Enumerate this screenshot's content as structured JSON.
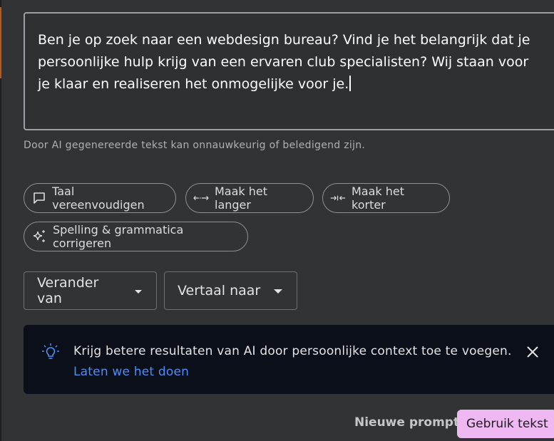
{
  "editor": {
    "text": "Ben je op zoek naar een webdesign bureau? Vind je het belangrijk dat je persoonlijke hulp krijg van een ervaren club specialisten? Wij staan voor je klaar en realiseren het onmogelijke voor je."
  },
  "disclaimer": "Door AI gegenereerde tekst kan onnauwkeurig of beledigend zijn.",
  "chips": {
    "simplify": "Taal vereenvoudigen",
    "longer": "Maak het langer",
    "shorter": "Maak het korter",
    "spelling": "Spelling & grammatica corrigeren"
  },
  "dropdowns": {
    "change_from": "Verander van",
    "translate_to": "Vertaal naar"
  },
  "banner": {
    "message": "Krijg betere resultaten van AI door persoonlijke context toe te voegen.",
    "link": "Laten we het doen"
  },
  "actions": {
    "new_prompt": "Nieuwe prompt",
    "use_text": "Gebruik tekst"
  },
  "colors": {
    "background": "#323334",
    "link": "#4c8df6",
    "primary_button": "#efb8f2",
    "banner_bg": "#0b0f1a",
    "accent_strip": "#b35a1f"
  },
  "icons": [
    "chat-bubble-icon",
    "expand-arrows-icon",
    "collapse-arrows-icon",
    "sparkle-icon",
    "chevron-down-icon",
    "lightbulb-icon",
    "close-icon"
  ]
}
